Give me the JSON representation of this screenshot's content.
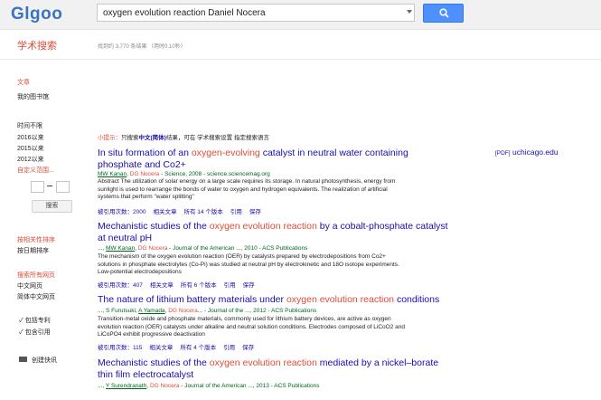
{
  "header": {
    "logo": "Glgoo",
    "search_query": "oxygen evolution reaction Daniel Nocera"
  },
  "subheader": {
    "scholar_title": "学术搜索",
    "stats": "找到约 3,770 条结果 （用时0.10秒）"
  },
  "sidebar": {
    "articles": "文章",
    "library": "我的图书馆",
    "time_any": "时间不限",
    "since_2016": "2016以来",
    "since_2015": "2015以来",
    "since_2012": "2012以来",
    "custom_range": "自定义范围...",
    "search_button": "搜索",
    "sort_relevance": "按相关性排序",
    "sort_date": "按日期排序",
    "all_pages": "搜索所有网页",
    "chinese_pages": "中文网页",
    "simplified_pages": "简体中文网页",
    "include_patents": "包括专利",
    "include_citations": "包含引用",
    "create_alert": "创建快讯"
  },
  "tip": {
    "prefix": "小提示：",
    "text1": "只搜索",
    "bold": "中文(简体)",
    "text2": "结果，可在 学术搜索设置 指定搜索语言"
  },
  "results": [
    {
      "title_pre": "In situ formation of an ",
      "title_hl": "oxygen-evolving",
      "title_post": " catalyst in neutral water containing phosphate and Co2+",
      "author1": "MW Kanan",
      "author2": "DG Nocera",
      "source": " - Science, 2008 - science.sciencemag.org",
      "abstract": "Abstract The utilization of solar energy on a large scale requires its storage. In natural photosynthesis, energy from sunlight is used to rearrange the bonds of water to oxygen and hydrogen equivalents. The realization of artificial systems that perform \"water splitting\"",
      "cited": "被引用次数：2000",
      "related": "相关文章",
      "versions": "所有 14 个版本",
      "cite": "引用",
      "save": "保存",
      "pdf_tag": "[PDF]",
      "pdf_source": "uchicago.edu"
    },
    {
      "title_pre": "Mechanistic studies of the ",
      "title_hl": "oxygen evolution reaction",
      "title_post": " by a cobalt-phosphate catalyst at neutral pH",
      "author_prefix": "..., ",
      "author1": "MW Kanan",
      "author2": "DG Nocera",
      "source": " - Journal of the American ..., 2010 - ACS Publications",
      "abstract": "The mechanism of the oxygen evolution reaction (OER) by catalysts prepared by electrodepositions from Co2+ solutions in phosphate electrolytes (Co-Pi) was studied at neutral pH by electrokinetic and 18O isotope experiments. Low-potential electrodepositions",
      "cited": "被引用次数：407",
      "related": "相关文章",
      "versions": "所有 6 个版本",
      "cite": "引用",
      "save": "保存"
    },
    {
      "title_pre": "The nature of lithium battery materials under ",
      "title_hl": "oxygen evolution reaction",
      "title_post": " conditions",
      "author_prefix": "..., S Furutsuki, ",
      "author1": "A Yamada",
      "author2": "DG Nocera",
      "source": "... - Journal of the ..., 2012 - ACS Publications",
      "abstract": "Transition-metal oxide and phosphate materials, commonly used for lithium battery devices, are active as oxygen evolution reaction (OER) catalysts under alkaline and neutral solution conditions. Electrodes composed of LiCoO2 and LiCoPO4 exhibit progressive deactivation",
      "cited": "被引用次数：115",
      "related": "相关文章",
      "versions": "所有 4 个版本",
      "cite": "引用",
      "save": "保存"
    },
    {
      "title_pre": "Mechanistic studies of the ",
      "title_hl": "oxygen evolution reaction",
      "title_post": " mediated by a nickel–borate thin film electrocatalyst",
      "author_prefix": "..., ",
      "author1": "Y Surendranath",
      "author2": "DG Nocera",
      "source": " - Journal of the American ..., 2013 - ACS Publications"
    }
  ],
  "colors": {
    "brand": "#3a73c4",
    "accent_red": "#dd4b39",
    "link": "#1a0dab",
    "green": "#006621",
    "button": "#4d90fe"
  }
}
